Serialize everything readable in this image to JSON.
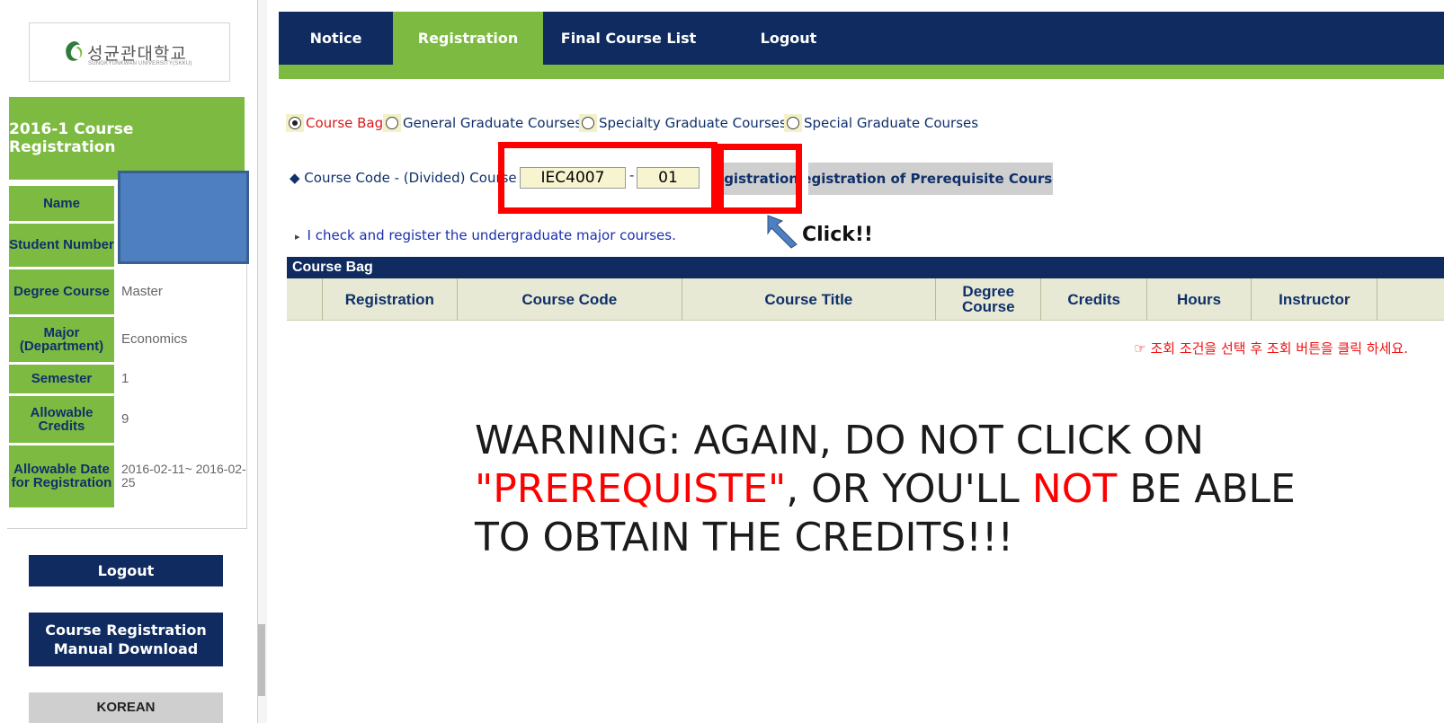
{
  "sidebar": {
    "logo_text": "성균관대학교",
    "logo_sub": "SUNGKYUNKWAN UNIVERSITY(SKKU)",
    "title": "2016-1 Course Registration",
    "fields": [
      {
        "label": "Name",
        "value": ""
      },
      {
        "label": "Student Number",
        "value": ""
      },
      {
        "label": "Degree Course",
        "value": "Master"
      },
      {
        "label": "Major (Department)",
        "value": "Economics"
      },
      {
        "label": "Semester",
        "value": "1"
      },
      {
        "label": "Allowable Credits",
        "value": "9"
      },
      {
        "label": "Allowable Date for Registration",
        "value": "2016-02-11~ 2016-02-25"
      }
    ],
    "logout_button": "Logout",
    "manual_button": "Course Registration Manual Download",
    "korean_button": "KOREAN"
  },
  "nav": {
    "tabs": [
      "Notice",
      "Registration",
      "Final Course List",
      "Logout"
    ],
    "active_tab": "Registration"
  },
  "filters": {
    "options": [
      "Course Bag",
      "General Graduate Courses",
      "Specialty Graduate Courses",
      "Special Graduate Courses"
    ],
    "selected": "Course Bag"
  },
  "course_code": {
    "label": "◆ Course Code - (Divided) Course :",
    "code_value": "IEC4007",
    "separator": "-",
    "division_value": "01",
    "register_button": "Registration",
    "prereq_button": "Registration of Prerequisite Courses"
  },
  "annotation": {
    "click_label": "Click!!"
  },
  "check_link": "I check and register the undergraduate major courses.",
  "course_bag": {
    "title": "Course Bag",
    "columns": [
      "",
      "Registration",
      "Course Code",
      "Course Title",
      "Degree Course",
      "Credits",
      "Hours",
      "Instructor",
      ""
    ],
    "notice": "☞ 조회 조건을 선택 후 조회 버튼을 클릭 하세요."
  },
  "warning": {
    "part1": "WARNING: AGAIN, DO NOT CLICK ON",
    "part2_red": "\"PREREQUISTE\"",
    "part3": ", OR YOU'LL",
    "part4_red": "NOT",
    "part5": "BE ABLE",
    "part6": "TO OBTAIN THE CREDITS!!!"
  },
  "colors": {
    "navy": "#0f2b60",
    "green": "#7dba41",
    "highlight_red": "#ff0000",
    "redaction_blue": "#4e7fc0"
  }
}
